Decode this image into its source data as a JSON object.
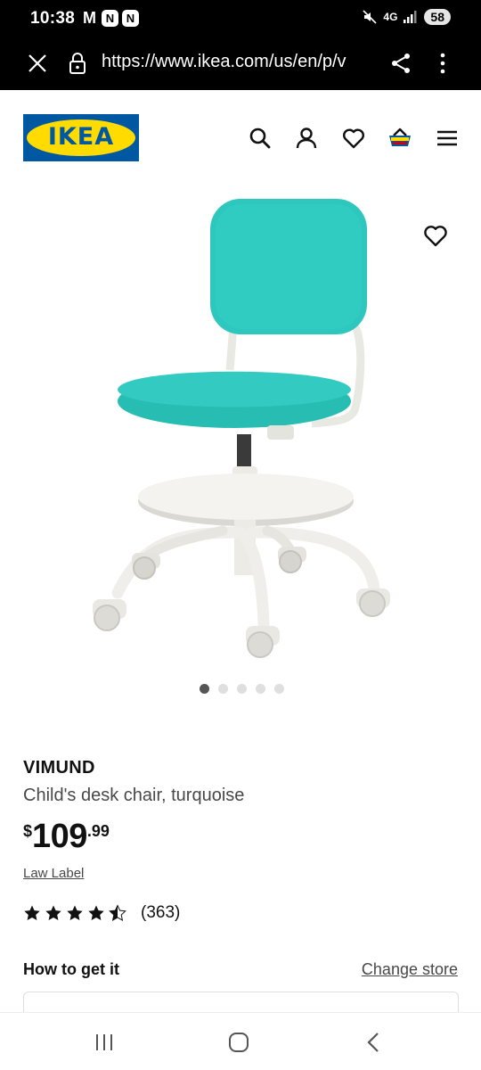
{
  "status_bar": {
    "time": "10:38",
    "mail_glyph": "M",
    "app_badge_1": "N",
    "app_badge_2": "N",
    "network": "4G",
    "battery": "58"
  },
  "browser": {
    "url": "https://www.ikea.com/us/en/p/v"
  },
  "header": {
    "logo_text": "IKEA",
    "icons": [
      "search-icon",
      "account-icon",
      "favorites-icon",
      "cart-icon",
      "menu-icon"
    ]
  },
  "gallery": {
    "dot_count": 5,
    "active_dot": 1
  },
  "product": {
    "name": "VIMUND",
    "description": "Child's desk chair, turquoise",
    "price_currency": "$",
    "price_whole": "109",
    "price_cents": ".99",
    "law_label": "Law Label",
    "rating_count": "(363)",
    "rating_value": 4.5,
    "rating_max": 5
  },
  "delivery": {
    "title": "How to get it",
    "change_store": "Change store"
  },
  "colors": {
    "ikea_blue": "#0058a3",
    "ikea_yellow": "#ffdb00",
    "chair_turquoise": "#2ec7bd",
    "frame_white": "#f2f2ee"
  }
}
